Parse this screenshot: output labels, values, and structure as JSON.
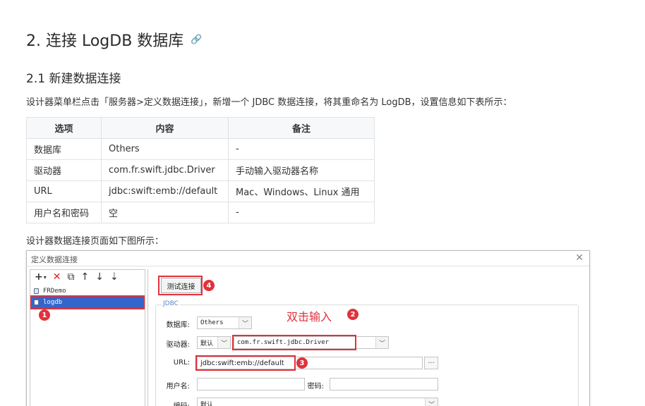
{
  "heading": {
    "title": "2. 连接 LogDB 数据库",
    "anchor_icon": "link-icon"
  },
  "subheading": "2.1 新建数据连接",
  "intro_text": "设计器菜单栏点击「服务器>定义数据连接」，新增一个 JDBC 数据连接，将其重命名为 LogDB，设置信息如下表所示：",
  "table": {
    "headers": [
      "选项",
      "内容",
      "备注"
    ],
    "rows": [
      [
        "数据库",
        "Others",
        "-"
      ],
      [
        "驱动器",
        "com.fr.swift.jdbc.Driver",
        "手动输入驱动器名称"
      ],
      [
        "URL",
        "jdbc:swift:emb://default",
        "Mac、Windows、Linux 通用"
      ],
      [
        "用户名和密码",
        "空",
        "-"
      ]
    ]
  },
  "caption_text": "设计器数据连接页面如下图所示：",
  "dialog": {
    "title": "定义数据连接",
    "close_icon": "close-icon",
    "toolbar": {
      "add": "+",
      "add_dropdown": "▾",
      "delete": "✕",
      "copy": "⧉",
      "up": "↑",
      "down": "↓",
      "sort": "⇣"
    },
    "connections": [
      "FRDemo",
      "logdb"
    ],
    "test_button": "测试连接",
    "group_label": "JDBC",
    "double_click_hint": "双击输入",
    "fields": {
      "database_label": "数据库:",
      "database_value": "Others",
      "driver_label": "驱动器:",
      "driver_mode": "默认",
      "driver_value": "com.fr.swift.jdbc.Driver",
      "url_label": "URL:",
      "url_value": "jdbc:swift:emb://default",
      "url_more": "···",
      "username_label": "用户名:",
      "username_value": "",
      "password_label": "密码:",
      "password_value": "",
      "encoding_label": "编码:",
      "encoding_value": "默认"
    },
    "badges": [
      "1",
      "2",
      "3",
      "4"
    ],
    "accent_color": "#e0323c",
    "selection_color": "#3366cc"
  }
}
